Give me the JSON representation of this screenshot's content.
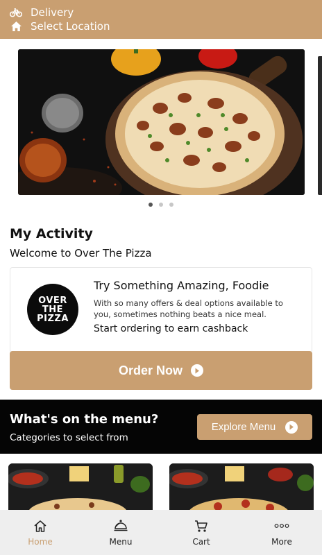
{
  "header": {
    "mode_label": "Delivery",
    "location_label": "Select Location"
  },
  "carousel": {
    "slide_count": 3,
    "active_index": 0
  },
  "activity": {
    "title": "My Activity",
    "welcome": "Welcome to Over The Pizza"
  },
  "promo": {
    "logo_lines": [
      "OVER",
      "THE",
      "PIZZA"
    ],
    "title": "Try Something Amazing, Foodie",
    "description": "With so many offers & deal options available to you, sometimes nothing beats a nice meal.",
    "cta_text": "Start ordering to earn cashback"
  },
  "order_button": {
    "label": "Order Now"
  },
  "menu_section": {
    "title": "What's on the menu?",
    "subtitle": "Categories to select from",
    "explore_label": "Explore Menu"
  },
  "bottom_nav": {
    "items": [
      {
        "label": "Home",
        "icon": "home-icon",
        "active": true
      },
      {
        "label": "Menu",
        "icon": "cloche-icon",
        "active": false
      },
      {
        "label": "Cart",
        "icon": "cart-icon",
        "active": false
      },
      {
        "label": "More",
        "icon": "more-dots-icon",
        "active": false
      }
    ]
  },
  "colors": {
    "brand": "#c99f71",
    "dark_strip": "#050505",
    "nav_bg": "#eeeeee"
  }
}
